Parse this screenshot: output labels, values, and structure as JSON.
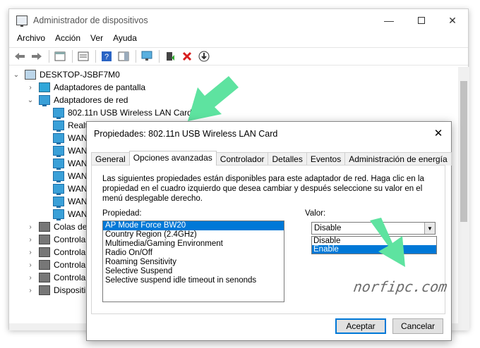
{
  "window": {
    "title": "Administrador de dispositivos",
    "controls": {
      "minimize": "—",
      "close": "✕"
    }
  },
  "menu": [
    "Archivo",
    "Acción",
    "Ver",
    "Ayuda"
  ],
  "toolbar_icons": [
    "back-icon",
    "forward-icon",
    "show-hide-tree-icon",
    "properties-icon",
    "help-icon",
    "action-pane-icon",
    "scan-hardware-icon",
    "update-driver-icon",
    "uninstall-icon",
    "download-icon"
  ],
  "tree": {
    "root": "DESKTOP-JSBF7M0",
    "items": [
      {
        "label": "Adaptadores de pantalla",
        "expander": "›"
      },
      {
        "label": "Adaptadores de red",
        "expander": "⌄"
      },
      {
        "label": "802.11n USB Wireless LAN Card"
      },
      {
        "label": "Realt"
      },
      {
        "label": "WAN"
      },
      {
        "label": "WAN"
      },
      {
        "label": "WAN"
      },
      {
        "label": "WAN"
      },
      {
        "label": "WAN"
      },
      {
        "label": "WAN"
      },
      {
        "label": "WAN"
      },
      {
        "label": "Colas de",
        "expander": "›"
      },
      {
        "label": "Controla",
        "expander": "›"
      },
      {
        "label": "Controla",
        "expander": "›"
      },
      {
        "label": "Controla",
        "expander": "›"
      },
      {
        "label": "Controla",
        "expander": "›"
      },
      {
        "label": "Dispositi",
        "expander": "›"
      }
    ]
  },
  "dialog": {
    "title": "Propiedades: 802.11n USB Wireless LAN Card",
    "close": "✕",
    "tabs": [
      "General",
      "Opciones avanzadas",
      "Controlador",
      "Detalles",
      "Eventos",
      "Administración de energía"
    ],
    "active_tab": "Opciones avanzadas",
    "description": "Las siguientes propiedades están disponibles para este adaptador de red. Haga clic en la propiedad en el cuadro izquierdo que desea cambiar y después seleccione su valor en el menú desplegable derecho.",
    "property_label": "Propiedad:",
    "properties": [
      "AP Mode Force BW20",
      "Country Region (2.4GHz)",
      "Multimedia/Gaming Environment",
      "Radio On/Off",
      "Roaming Sensitivity",
      "Selective Suspend",
      "Selective suspend idle timeout in senonds"
    ],
    "selected_property": "AP Mode Force BW20",
    "value_label": "Valor:",
    "value": "Disable",
    "value_options": [
      "Disable",
      "Enable"
    ],
    "highlighted_option": "Enable",
    "watermark": "norfipc.com",
    "ok_label": "Aceptar",
    "cancel_label": "Cancelar"
  },
  "colors": {
    "selection": "#0078d7",
    "arrow": "#5ee3a0"
  }
}
